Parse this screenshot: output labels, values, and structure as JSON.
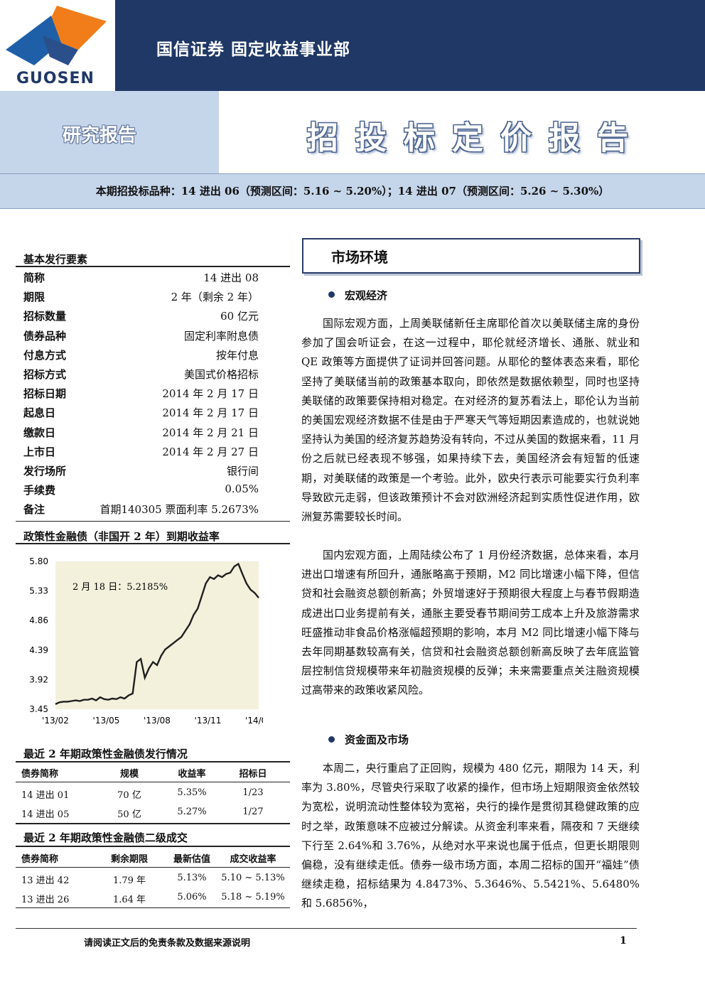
{
  "header": {
    "department": "国信证券 固定收益事业部",
    "logo_text": "GUOSEN",
    "research_label": "研究报告",
    "report_title": "招投标定价报告",
    "subtitle": "本期招投标品种：14 进出 06（预测区间：5.16 ~ 5.20%）；14 进出 07（预测区间：5.26 ~ 5.30%）"
  },
  "basic": {
    "title": "基本发行要素",
    "rows": [
      {
        "label": "简称",
        "value": "14 进出 08"
      },
      {
        "label": "期限",
        "value": "2 年（剩余 2 年）"
      },
      {
        "label": "招标数量",
        "value": "60 亿元"
      },
      {
        "label": "债券品种",
        "value": "固定利率附息债"
      },
      {
        "label": "付息方式",
        "value": "按年付息"
      },
      {
        "label": "招标方式",
        "value": "美国式价格招标"
      },
      {
        "label": "招标日期",
        "value": "2014 年 2 月 17 日"
      },
      {
        "label": "起息日",
        "value": "2014 年 2 月 17 日"
      },
      {
        "label": "缴款日",
        "value": "2014 年 2 月 21 日"
      },
      {
        "label": "上市日",
        "value": "2014 年 2 月 27 日"
      },
      {
        "label": "发行场所",
        "value": "银行间"
      },
      {
        "label": "手续费",
        "value": "0.05%"
      },
      {
        "label": "备注",
        "value": "首期140305 票面利率 5.2673%"
      }
    ]
  },
  "chart_section_title": "政策性金融债（非国开 2 年）到期收益率",
  "chart_data": {
    "type": "line",
    "annotation": "2 月 18 日：5.2185%",
    "x_ticks": [
      "'13/02",
      "'13/05",
      "'13/08",
      "'13/11",
      "'14/02"
    ],
    "y_ticks": [
      "5.80",
      "5.33",
      "4.86",
      "4.39",
      "3.92",
      "3.45"
    ],
    "ylim": [
      3.45,
      5.8
    ],
    "series": [
      {
        "x": [
          0,
          0.02,
          0.04,
          0.06,
          0.08,
          0.1,
          0.12,
          0.14,
          0.16,
          0.18,
          0.2,
          0.22,
          0.24,
          0.26,
          0.28,
          0.3,
          0.32,
          0.34,
          0.36,
          0.38,
          0.4,
          0.42,
          0.44,
          0.46,
          0.48,
          0.5,
          0.52,
          0.54,
          0.56,
          0.58,
          0.6,
          0.62,
          0.64,
          0.66,
          0.68,
          0.7,
          0.72,
          0.74,
          0.76,
          0.78,
          0.8,
          0.82,
          0.84,
          0.86,
          0.88,
          0.9,
          0.92,
          0.94,
          0.96,
          0.98,
          1.0
        ],
        "values": [
          3.53,
          3.56,
          3.57,
          3.57,
          3.58,
          3.59,
          3.58,
          3.6,
          3.6,
          3.62,
          3.59,
          3.64,
          3.61,
          3.6,
          3.62,
          3.61,
          3.64,
          3.62,
          3.67,
          3.7,
          4.2,
          4.25,
          3.95,
          4.1,
          4.2,
          4.15,
          4.3,
          4.4,
          4.45,
          4.5,
          4.55,
          4.6,
          4.7,
          4.8,
          4.95,
          5.05,
          5.25,
          5.45,
          5.55,
          5.52,
          5.58,
          5.55,
          5.6,
          5.62,
          5.72,
          5.76,
          5.6,
          5.45,
          5.35,
          5.3,
          5.22
        ]
      }
    ]
  },
  "issue_table": {
    "title": "最近 2 年期政策性金融债发行情况",
    "headers": [
      "债券简称",
      "规模",
      "收益率",
      "招标日"
    ],
    "rows": [
      [
        "14 进出 01",
        "70 亿",
        "5.35%",
        "1/23"
      ],
      [
        "14 进出 05",
        "50 亿",
        "5.27%",
        "1/27"
      ]
    ]
  },
  "trade_table": {
    "title": "最近 2 年期政策性金融债二级成交",
    "headers": [
      "债券简称",
      "剩余期限",
      "最新估值",
      "成交收益率"
    ],
    "rows": [
      [
        "13 进出 42",
        "1.79 年",
        "5.13%",
        "5.10 ~ 5.13%"
      ],
      [
        "13 进出 26",
        "1.64 年",
        "5.06%",
        "5.18 ~ 5.19%"
      ]
    ]
  },
  "market": {
    "title": "市场环境",
    "sections": [
      {
        "heading": "宏观经济",
        "paragraphs": [
          "国际宏观方面，上周美联储新任主席耶伦首次以美联储主席的身份参加了国会听证会，在这一过程中，耶伦就经济增长、通胀、就业和 QE 政策等方面提供了证词并回答问题。从耶伦的整体表态来看，耶伦坚持了美联储当前的政策基本取向，即依然是数据依赖型，同时也坚持美联储的政策要保持相对稳定。在对经济的复苏看法上，耶伦认为当前的美国宏观经济数据不佳是由于严寒天气等短期因素造成的，也就说她坚持认为美国的经济复苏趋势没有转向，不过从美国的数据来看，11 月份之后就已经表现不够强，如果持续下去，美国经济会有短暂的低速期，对美联储的政策是一个考验。此外，欧央行表示可能要实行负利率导致欧元走弱，但该政策预计不会对欧洲经济起到实质性促进作用，欧洲复苏需要较长时间。",
          "国内宏观方面，上周陆续公布了 1 月份经济数据，总体来看，本月进出口增速有所回升，通胀略高于预期，M2 同比增速小幅下降，但信贷和社会融资总额创新高；外贸增速好于预期很大程度上与春节假期造成进出口业务提前有关，通胀主要受春节期间劳工成本上升及旅游需求旺盛推动非食品价格涨幅超预期的影响，本月 M2 同比增速小幅下降与去年同期基数较高有关，信贷和社会融资总额创新高反映了去年底监管层控制信贷规模带来年初融资规模的反弹；未来需要重点关注融资规模过高带来的政策收紧风险。"
        ]
      },
      {
        "heading": "资金面及市场",
        "paragraphs": [
          "本周二，央行重启了正回购，规模为 480 亿元，期限为 14 天，利率为 3.80%，尽管央行采取了收紧的操作，但市场上短期限资金依然较为宽松，说明流动性整体较为宽裕，央行的操作是贯彻其稳健政策的应时之举，政策意味不应被过分解读。从资金利率来看，隔夜和 7 天继续下行至 2.64%和 3.76%，从绝对水平来说也属于低点，但更长期限则偏稳，没有继续走低。债券一级市场方面，本周二招标的国开“福娃”债继续走稳，招标结果为 4.8473%、5.3646%、5.5421%、5.6480%和 5.6856%，"
        ]
      }
    ]
  },
  "footer": {
    "note": "请阅读正文后的免责条款及数据来源说明",
    "page": "1"
  },
  "colors": {
    "navy": "#1f3866",
    "light_blue": "#c5d5ea",
    "orange": "#f07d1a",
    "chart_bg": "#f3f1dc"
  }
}
